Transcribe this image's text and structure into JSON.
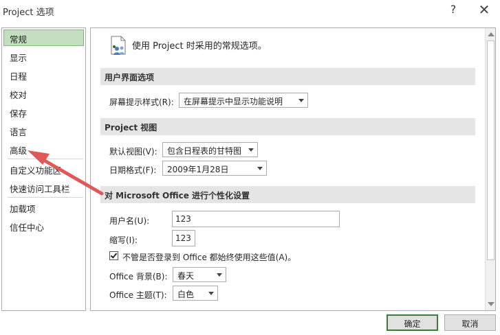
{
  "window": {
    "title": "Project 选项",
    "help": "?",
    "close": "✕"
  },
  "nav": {
    "items": [
      {
        "label": "常规",
        "selected": true
      },
      {
        "label": "显示"
      },
      {
        "label": "日程"
      },
      {
        "label": "校对"
      },
      {
        "label": "保存"
      },
      {
        "label": "语言"
      },
      {
        "label": "高级"
      },
      {
        "label": "自定义功能区"
      },
      {
        "label": "快速访问工具栏"
      },
      {
        "label": "加载项"
      },
      {
        "label": "信任中心"
      }
    ]
  },
  "main": {
    "header": "使用 Project 时采用的常规选项。",
    "sections": {
      "ui": "用户界面选项",
      "view": "Project 视图",
      "personalize": "对 Microsoft Office 进行个性化设置"
    },
    "screentip": {
      "label": "屏幕提示样式(R):",
      "value": "在屏幕提示中显示功能说明"
    },
    "default_view": {
      "label": "默认视图(V):",
      "value": "包含日程表的甘特图"
    },
    "date_format": {
      "label": "日期格式(F):",
      "value": "2009年1月28日"
    },
    "username": {
      "label": "用户名(U):",
      "value": "123"
    },
    "initials": {
      "label": "缩写(I):",
      "value": "123"
    },
    "always_use": {
      "label": "不管是否登录到 Office 都始终使用这些值(A)。",
      "checked": true
    },
    "office_background": {
      "label": "Office 背景(B):",
      "value": "春天"
    },
    "office_theme": {
      "label": "Office 主题(T):",
      "value": "白色"
    }
  },
  "footer": {
    "ok": "确定",
    "cancel": "取消"
  },
  "colors": {
    "nav_selected_bg": "#c3dfc0",
    "section_bg": "#e5e5e5",
    "annotation_arrow": "#e05858"
  }
}
